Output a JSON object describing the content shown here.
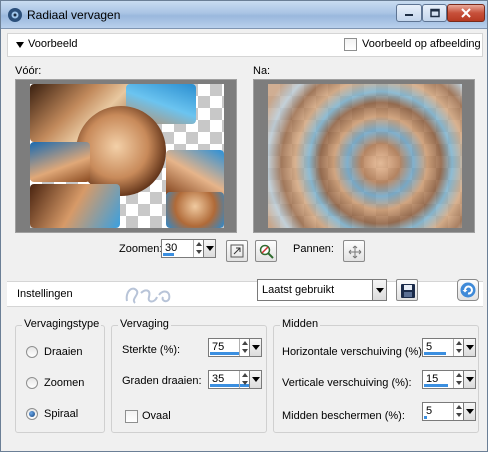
{
  "window": {
    "title": "Radiaal vervagen"
  },
  "preview": {
    "header_label": "Voorbeeld",
    "preview_on_image_label": "Voorbeeld op afbeelding",
    "preview_on_image_checked": false,
    "before_label": "Vóór:",
    "after_label": "Na:",
    "zoom_label": "Zoomen:",
    "zoom_value": "30",
    "zoom_fill": 0.3,
    "pan_label": "Pannen:"
  },
  "settings": {
    "label": "Instellingen",
    "preset_value": "Laatst gebruikt"
  },
  "blur_type": {
    "title": "Vervagingstype",
    "options": [
      {
        "label": "Draaien",
        "selected": false
      },
      {
        "label": "Zoomen",
        "selected": false
      },
      {
        "label": "Spiraal",
        "selected": true
      }
    ]
  },
  "blur": {
    "title": "Vervaging",
    "strength_label": "Sterkte (%):",
    "strength_value": "75",
    "strength_fill": 0.75,
    "rotate_label": "Graden draaien:",
    "rotate_value": "35",
    "rotate_fill": 0.5,
    "oval_label": "Ovaal",
    "oval_checked": false
  },
  "center": {
    "title": "Midden",
    "h_offset_label": "Horizontale verschuiving (%):",
    "h_offset_value": "5",
    "v_offset_label": "Verticale verschuiving (%):",
    "v_offset_value": "15",
    "protect_label": "Midden beschermen (%):",
    "protect_value": "5"
  }
}
